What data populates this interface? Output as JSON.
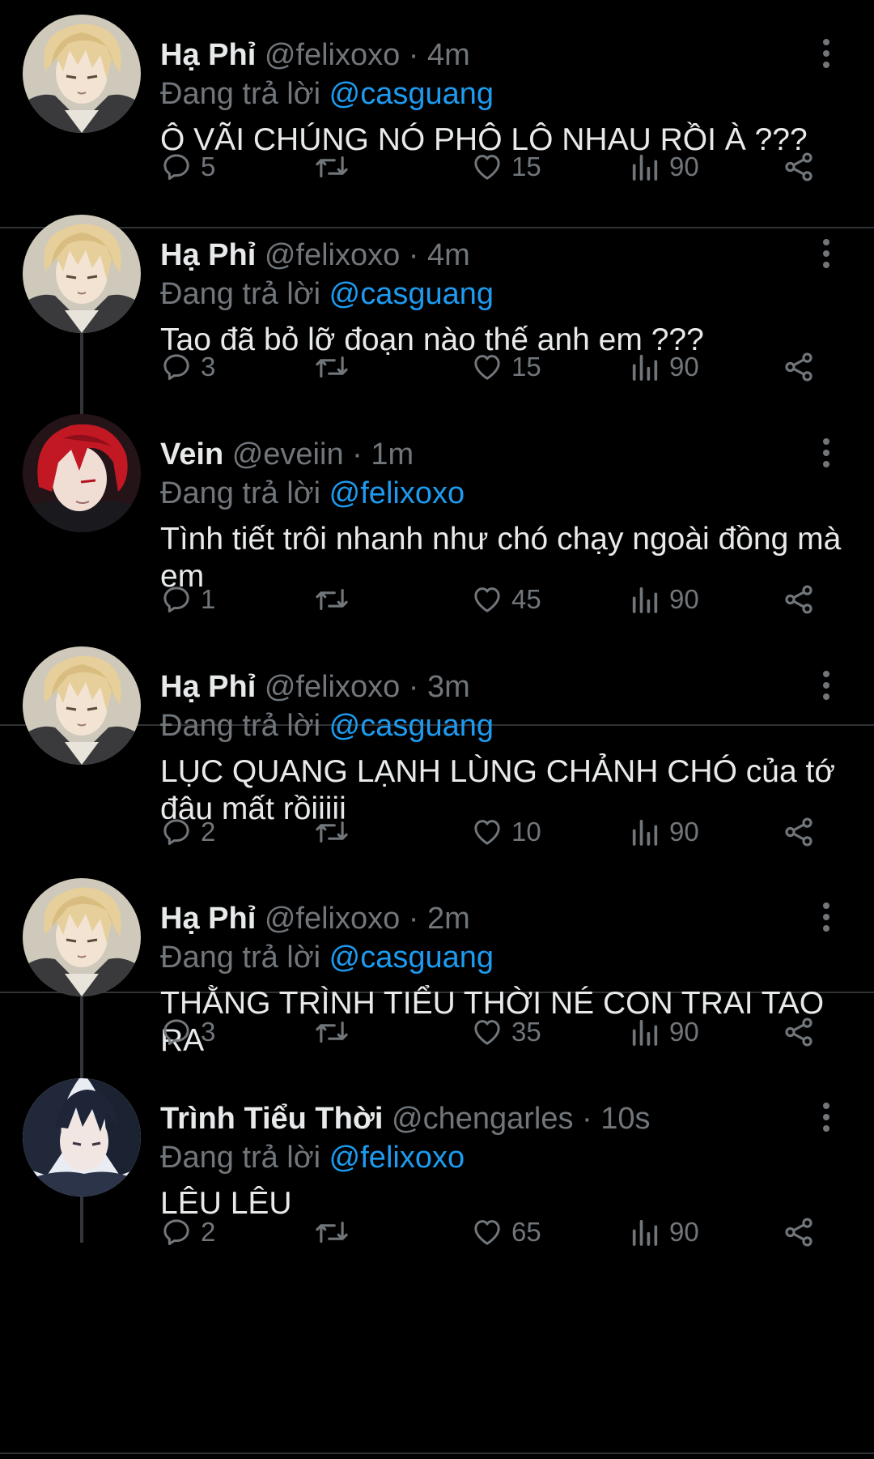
{
  "colors": {
    "background": "#000000",
    "text_primary": "#e7e9ea",
    "text_secondary": "#71767b",
    "accent": "#1d9bf0",
    "divider": "#2f3336"
  },
  "reply_prefix": "Đang trả lời",
  "icons": [
    "reply-icon",
    "retweet-icon",
    "like-icon",
    "views-icon",
    "share-icon",
    "more-options-icon"
  ],
  "tweets": [
    {
      "avatar": "avatar-blonde",
      "display_name": "Hạ Phỉ",
      "meta": "@felixoxo · 4m",
      "reply_to": "@casguang",
      "text": "Ô VÃI CHÚNG NÓ PHÔ LÔ NHAU RỒI À ???",
      "replies": "5",
      "retweets": "",
      "likes": "15",
      "views": "90"
    },
    {
      "avatar": "avatar-blonde",
      "display_name": "Hạ Phỉ",
      "meta": "@felixoxo · 4m",
      "reply_to": "@casguang",
      "text": "Tao đã bỏ lỡ đoạn nào thế anh em ???",
      "replies": "3",
      "retweets": "",
      "likes": "15",
      "views": "90"
    },
    {
      "avatar": "avatar-red",
      "display_name": "Vein",
      "meta": "@eveiin · 1m",
      "reply_to": "@felixoxo",
      "text": "Tình tiết trôi nhanh như chó chạy ngoài đồng mà em",
      "replies": "1",
      "retweets": "",
      "likes": "45",
      "views": "90"
    },
    {
      "avatar": "avatar-blonde",
      "display_name": "Hạ Phỉ",
      "meta": "@felixoxo · 3m",
      "reply_to": "@casguang",
      "text": "LỤC QUANG LẠNH LÙNG CHẢNH CHÓ của tớ đâu mất rồiiiii",
      "replies": "2",
      "retweets": "",
      "likes": "10",
      "views": "90"
    },
    {
      "avatar": "avatar-blonde",
      "display_name": "Hạ Phỉ",
      "meta": "@felixoxo · 2m",
      "reply_to": "@casguang",
      "text": "THẰNG TRÌNH TIỂU THỜI NÉ CON TRAI TAO RA",
      "replies": "3",
      "retweets": "",
      "likes": "35",
      "views": "90"
    },
    {
      "avatar": "avatar-dark",
      "display_name": "Trình Tiểu Thời",
      "meta": "@chengarles · 10s",
      "reply_to": "@felixoxo",
      "text": "LÊU LÊU",
      "replies": "2",
      "retweets": "",
      "likes": "65",
      "views": "90"
    }
  ]
}
